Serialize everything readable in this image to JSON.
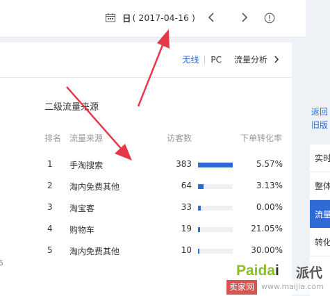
{
  "header": {
    "date_prefix": "日",
    "date_value": "( 2017-04-16 )",
    "icons": {
      "calendar": "calendar-icon",
      "prev": "chevron-left-icon",
      "next": "chevron-right-icon",
      "info": "info-icon"
    }
  },
  "card": {
    "tabs": {
      "wireless": "无线",
      "pc": "PC",
      "analysis": "流量分析"
    },
    "section_title": "二级流量来源",
    "columns": {
      "rank": "排名",
      "source": "流量来源",
      "visitors": "访客数",
      "conversion": "下单转化率"
    },
    "rows": [
      {
        "rank": "1",
        "source": "手淘搜索",
        "visitors": "383",
        "share": 1.0,
        "conversion": "5.57%"
      },
      {
        "rank": "2",
        "source": "淘内免费其他",
        "visitors": "64",
        "share": 0.167,
        "conversion": "3.13%"
      },
      {
        "rank": "3",
        "source": "淘宝客",
        "visitors": "33",
        "share": 0.086,
        "conversion": "0.00%"
      },
      {
        "rank": "4",
        "source": "购物车",
        "visitors": "19",
        "share": 0.05,
        "conversion": "21.05%"
      },
      {
        "rank": "5",
        "source": "淘内免费其他",
        "visitors": "10",
        "share": 0.026,
        "conversion": "30.00%"
      }
    ]
  },
  "side": {
    "links": [
      "返回",
      "旧版"
    ],
    "items": [
      {
        "label": "实时"
      },
      {
        "label": "整体"
      },
      {
        "label": "流量"
      },
      {
        "label": "转化"
      }
    ],
    "left_digit": "5"
  },
  "watermark": {
    "paidai": "Paida",
    "paidai_i": "i",
    "zh": "派代",
    "badge": "卖家网",
    "url": "www.maijia.com"
  },
  "colors": {
    "accent": "#2e6bd5",
    "arrow": "#e5394a",
    "watermark_green": "#8bbf2a"
  }
}
